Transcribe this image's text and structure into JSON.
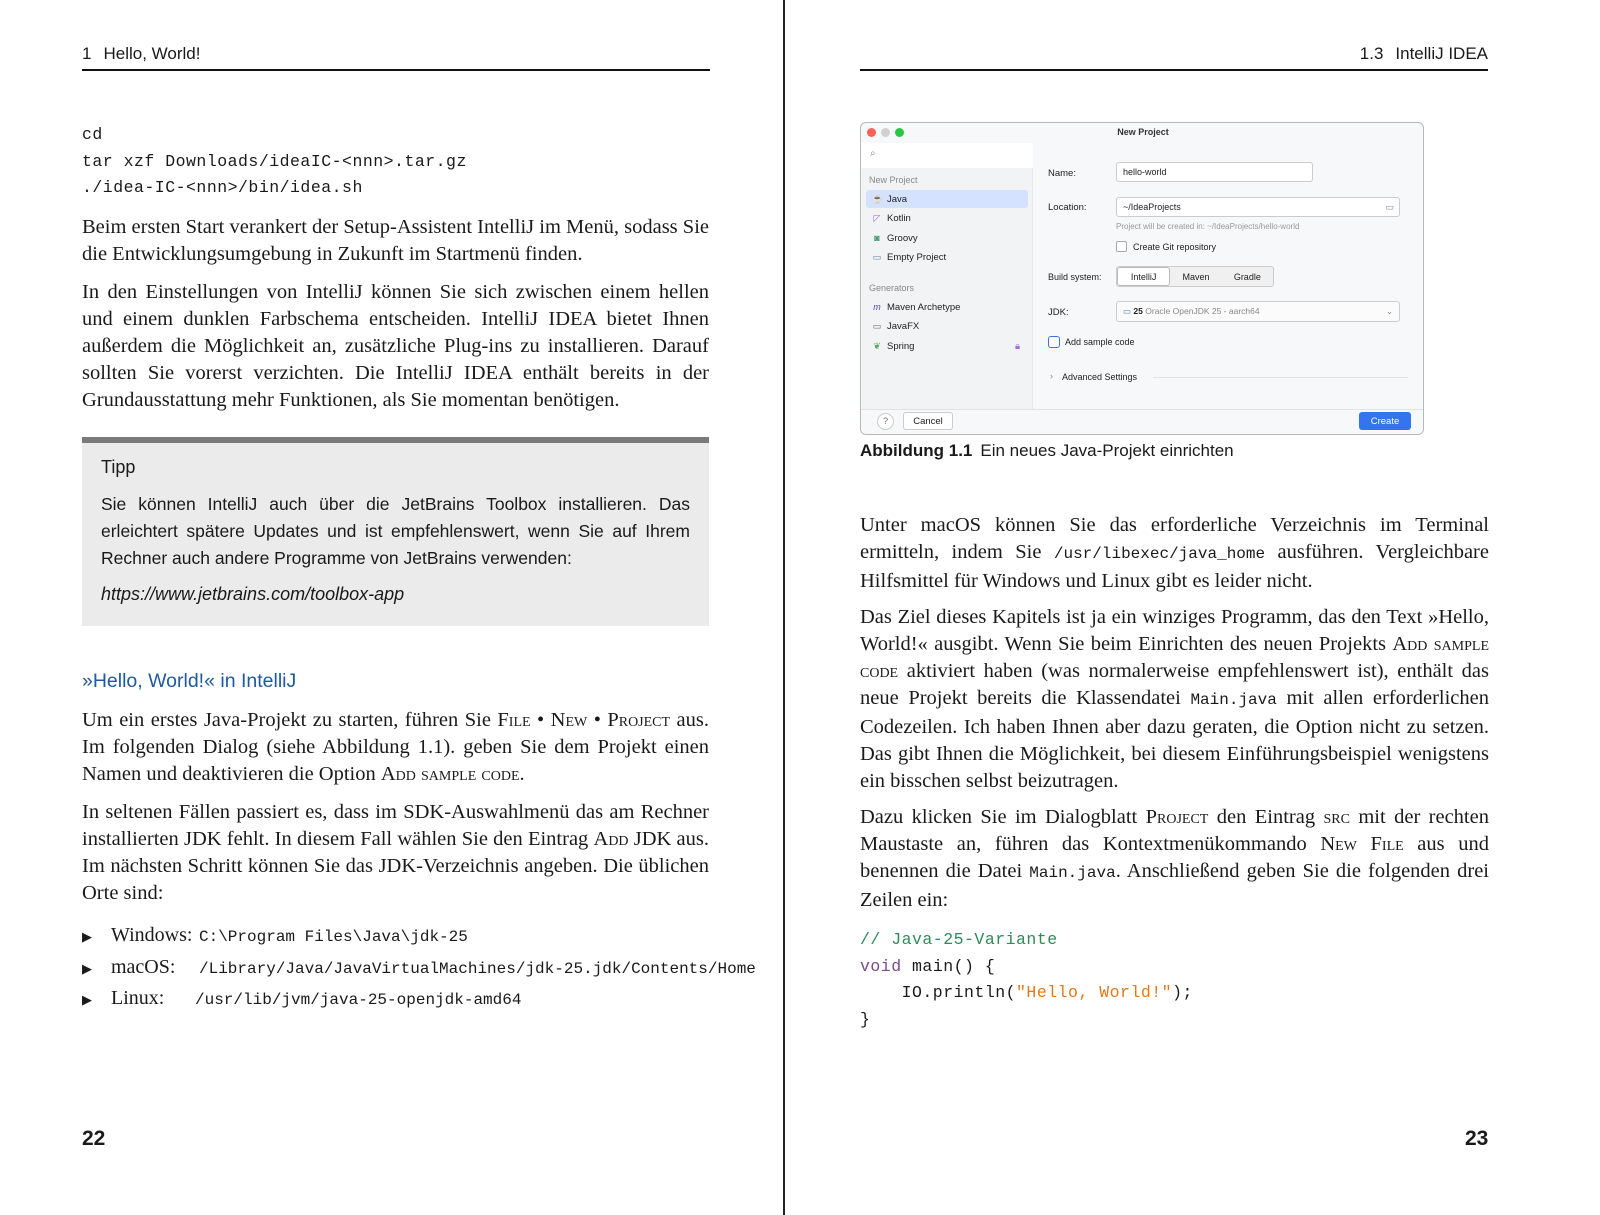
{
  "left": {
    "header": {
      "number": "1",
      "title": "Hello, World!"
    },
    "code": [
      "cd",
      "tar xzf Downloads/ideaIC-<nnn>.tar.gz",
      "./idea-IC-<nnn>/bin/idea.sh"
    ],
    "p1": "Beim ersten Start verankert der Setup-Assistent IntelliJ im Menü, sodass Sie die Entwicklungsumgebung in Zukunft im Startmenü finden.",
    "p2": "In den Einstellungen von IntelliJ können Sie sich zwischen einem hellen und einem dunklen Farbschema entscheiden. IntelliJ IDEA bietet Ihnen außerdem die Möglichkeit an, zusätzliche Plug-ins zu installieren. Darauf sollten Sie vorerst verzichten. Die IntelliJ IDEA enthält bereits in der Grundausstattung mehr Funktionen, als Sie momentan benötigen.",
    "tip": {
      "title": "Tipp",
      "text": "Sie können IntelliJ auch über die JetBrains Toolbox installieren. Das erleichtert spätere Updates und ist empfehlenswert, wenn Sie auf Ihrem Rechner auch andere Programme von JetBrains verwenden:",
      "url": "https://www.jetbrains.com/toolbox-app"
    },
    "section_title": "»Hello, World!« in IntelliJ",
    "p3": [
      "Um ein erstes Java-Projekt zu starten, führen Sie ",
      "File",
      " • ",
      "New",
      " • ",
      "Project",
      " aus. Im folgenden Dialog (siehe Abbildung 1.1). geben Sie dem Projekt einen Namen und deaktivieren die Option ",
      "Add sample code",
      "."
    ],
    "p4": [
      "In seltenen Fällen passiert es, dass im SDK-Auswahlmenü das am Rechner installierten JDK fehlt. In diesem Fall wählen Sie den Eintrag ",
      "Add JDK",
      " aus. Im nächsten Schritt können Sie das JDK-Verzeichnis angeben. Die üblichen Orte sind:"
    ],
    "list": [
      {
        "label": "Windows:",
        "path": "C:\\Program Files\\Java\\jdk-25"
      },
      {
        "label": "macOS:",
        "path": "/Library/Java/JavaVirtualMachines/jdk-25.jdk/Contents/Home"
      },
      {
        "label": "Linux:",
        "path": "/usr/lib/jvm/java-25-openjdk-amd64"
      }
    ],
    "page_number": "22"
  },
  "right": {
    "header": {
      "number": "1.3",
      "title": "IntelliJ IDEA"
    },
    "dialog": {
      "title": "New Project",
      "sidebar_section1": "New Project",
      "items": [
        "Java",
        "Kotlin",
        "Groovy",
        "Empty Project"
      ],
      "sidebar_section2": "Generators",
      "generators": [
        "Maven Archetype",
        "JavaFX",
        "Spring"
      ],
      "name_label": "Name:",
      "name_value": "hello-world",
      "location_label": "Location:",
      "location_value": "~/IdeaProjects",
      "location_hint": "Project will be created in: ~/IdeaProjects/hello-world",
      "git_label": "Create Git repository",
      "build_label": "Build system:",
      "build_options": [
        "IntelliJ",
        "Maven",
        "Gradle"
      ],
      "jdk_label": "JDK:",
      "jdk_version": "25",
      "jdk_value": "Oracle OpenJDK 25 - aarch64",
      "sample_label": "Add sample code",
      "advanced_label": "Advanced Settings",
      "help_label": "?",
      "cancel_label": "Cancel",
      "create_label": "Create",
      "accent": "#3574f0"
    },
    "caption": {
      "label": "Abbildung 1.1",
      "text": "Ein neues Java-Projekt einrichten"
    },
    "p5": [
      "Unter macOS können Sie das erforderliche Verzeichnis im Terminal ermitteln, indem Sie ",
      "/usr/libexec/java_home",
      " ausführen. Vergleichbare Hilfsmittel für Windows und Linux gibt es leider nicht."
    ],
    "p6": [
      "Das Ziel dieses Kapitels ist ja ein winziges Programm, das den Text »Hello, World!« ausgibt. Wenn Sie beim Einrichten des neuen Projekts ",
      "Add sample code",
      " aktiviert haben (was normalerweise empfehlenswert ist), enthält das neue Projekt bereits die Klassendatei ",
      "Main.java",
      " mit allen erforderlichen Codezeilen. Ich haben Ihnen aber dazu geraten, die Option nicht zu setzen. Das gibt Ihnen die Möglichkeit, bei diesem Einführungsbeispiel wenigstens ein bisschen selbst beizutragen."
    ],
    "p7": [
      "Dazu klicken Sie im Dialogblatt ",
      "Project",
      " den Eintrag ",
      "src",
      " mit der rechten Maustaste an, führen das Kontextmenükommando ",
      "New File",
      " aus und benennen die Datei ",
      "Main.java",
      ". Anschließend geben Sie die folgenden drei Zeilen ein:"
    ],
    "code": {
      "comment": "// Java-25-Variante",
      "keyword": "void",
      "line1_rest": " main() {",
      "line2_start": "    IO.println(",
      "string": "\"Hello, World!\"",
      "line2_end": ");",
      "line3": "}"
    },
    "page_number": "23"
  }
}
